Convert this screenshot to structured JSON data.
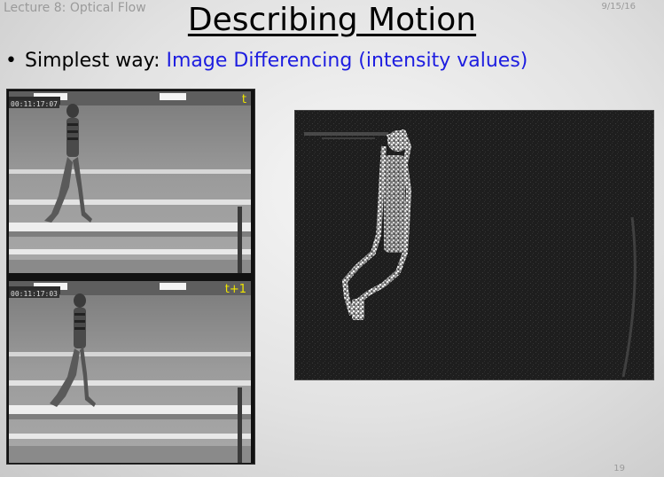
{
  "header": {
    "lecture": "Lecture 8: Optical Flow",
    "date": "9/15/16"
  },
  "slide": {
    "title": "Describing Motion",
    "bullet": {
      "marker": "•",
      "prefix": "Simplest way: ",
      "highlight": "Image Differencing (intensity values)"
    },
    "frames": [
      {
        "label": "t",
        "timecode": "00:11:17:07"
      },
      {
        "label": "t+1",
        "timecode": "00:11:17:03"
      }
    ],
    "page_number": "19"
  },
  "colors": {
    "highlight_text": "#1d1de0",
    "frame_label": "#f0e600"
  }
}
